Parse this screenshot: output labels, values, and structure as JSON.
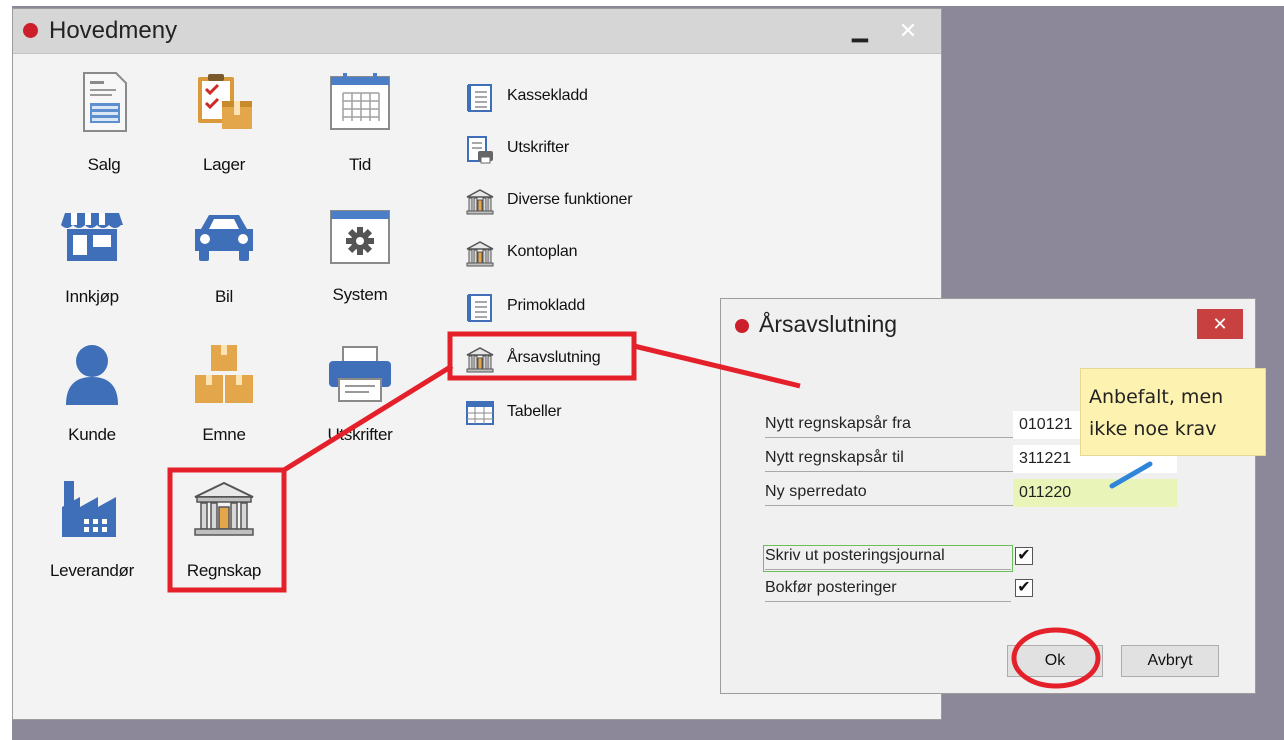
{
  "desktop": {
    "background": "#8d879a"
  },
  "main_window": {
    "title": "Hovedmeny",
    "minimize_glyph": "▁",
    "close_glyph": "✕",
    "tiles": [
      {
        "label": "Salg",
        "icon": "order-form-icon"
      },
      {
        "label": "Lager",
        "icon": "clipboard-boxes-icon"
      },
      {
        "label": "Tid",
        "icon": "calendar-icon"
      },
      {
        "label": "Innkjøp",
        "icon": "store-icon"
      },
      {
        "label": "Bil",
        "icon": "car-icon"
      },
      {
        "label": "System",
        "icon": "settings-window-icon"
      },
      {
        "label": "Kunde",
        "icon": "person-icon"
      },
      {
        "label": "Emne",
        "icon": "stacked-boxes-icon"
      },
      {
        "label": "Utskrifter",
        "icon": "printer-icon"
      },
      {
        "label": "Leverandør",
        "icon": "factory-icon"
      },
      {
        "label": "Regnskap",
        "icon": "bank-icon"
      }
    ],
    "list": [
      {
        "label": "Kassekladd",
        "icon": "ledger-icon"
      },
      {
        "label": "Utskrifter",
        "icon": "report-print-icon"
      },
      {
        "label": "Diverse funktioner",
        "icon": "bank-small-icon"
      },
      {
        "label": "Kontoplan",
        "icon": "bank-small-icon"
      },
      {
        "label": "Primokladd",
        "icon": "ledger-icon"
      },
      {
        "label": "Årsavslutning",
        "icon": "bank-small-icon"
      },
      {
        "label": "Tabeller",
        "icon": "table-icon"
      }
    ]
  },
  "dialog": {
    "title": "Årsavslutning",
    "close_glyph": "✕",
    "fields": [
      {
        "label": "Nytt regnskapsår fra",
        "value": "010121"
      },
      {
        "label": "Nytt regnskapsår til",
        "value": "311221"
      },
      {
        "label": "Ny sperredato",
        "value": "011220"
      }
    ],
    "checkboxes": [
      {
        "label": "Skriv ut posteringsjournal",
        "checked_glyph": "✔"
      },
      {
        "label": "Bokfør posteringer",
        "checked_glyph": "✔"
      }
    ],
    "ok_label": "Ok",
    "cancel_label": "Avbryt"
  },
  "annotation": {
    "note_line1": "Anbefalt, men",
    "note_line2": "ikke noe krav",
    "highlight_color": "#e4202a"
  }
}
